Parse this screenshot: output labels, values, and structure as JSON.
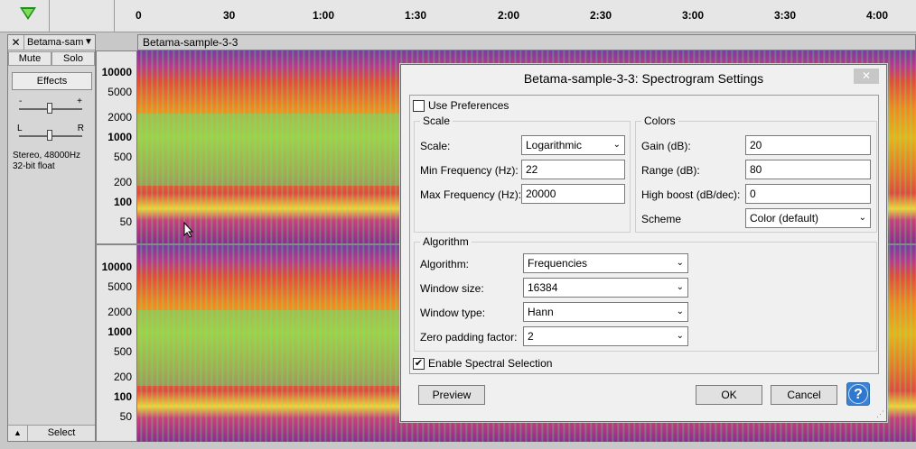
{
  "ruler": {
    "ticks": [
      "0",
      "30",
      "1:00",
      "1:30",
      "2:00",
      "2:30",
      "3:00",
      "3:30",
      "4:00"
    ]
  },
  "track": {
    "name": "Betama-sam",
    "close_label": "✕",
    "dropdown_label": "▼",
    "mute_label": "Mute",
    "solo_label": "Solo",
    "effects_label": "Effects",
    "gain_minus": "-",
    "gain_plus": "+",
    "pan_left": "L",
    "pan_right": "R",
    "format": "Stereo, 48000Hz\n32-bit float",
    "collapse_label": "▲",
    "select_label": "Select"
  },
  "clip": {
    "title": "Betama-sample-3-3"
  },
  "freq_ruler": {
    "top": [
      "10000",
      "5000",
      "2000",
      "1000",
      "500",
      "200",
      "100",
      "50"
    ],
    "bottom": [
      "10000",
      "5000",
      "2000",
      "1000",
      "500",
      "200",
      "100",
      "50"
    ]
  },
  "dialog": {
    "title": "Betama-sample-3-3: Spectrogram Settings",
    "close_label": "✕",
    "use_preferences": {
      "label": "Use Preferences",
      "checked": false
    },
    "scale": {
      "group_title": "Scale",
      "scale_label": "Scale:",
      "scale_value": "Logarithmic",
      "min_freq_label": "Min Frequency (Hz):",
      "min_freq_value": "22",
      "max_freq_label": "Max Frequency (Hz):",
      "max_freq_value": "20000"
    },
    "colors": {
      "group_title": "Colors",
      "gain_label": "Gain (dB):",
      "gain_value": "20",
      "range_label": "Range (dB):",
      "range_value": "80",
      "high_boost_label": "High boost (dB/dec):",
      "high_boost_value": "0",
      "scheme_label": "Scheme",
      "scheme_value": "Color (default)"
    },
    "algorithm": {
      "group_title": "Algorithm",
      "algorithm_label": "Algorithm:",
      "algorithm_value": "Frequencies",
      "window_size_label": "Window size:",
      "window_size_value": "16384",
      "window_type_label": "Window type:",
      "window_type_value": "Hann",
      "zero_padding_label": "Zero padding factor:",
      "zero_padding_value": "2"
    },
    "spectral_selection": {
      "label": "Enable Spectral Selection",
      "checked": true
    },
    "preview_label": "Preview",
    "ok_label": "OK",
    "cancel_label": "Cancel",
    "help_label": "?",
    "check_mark": "✔",
    "dropdown_arrow": "⌄"
  }
}
